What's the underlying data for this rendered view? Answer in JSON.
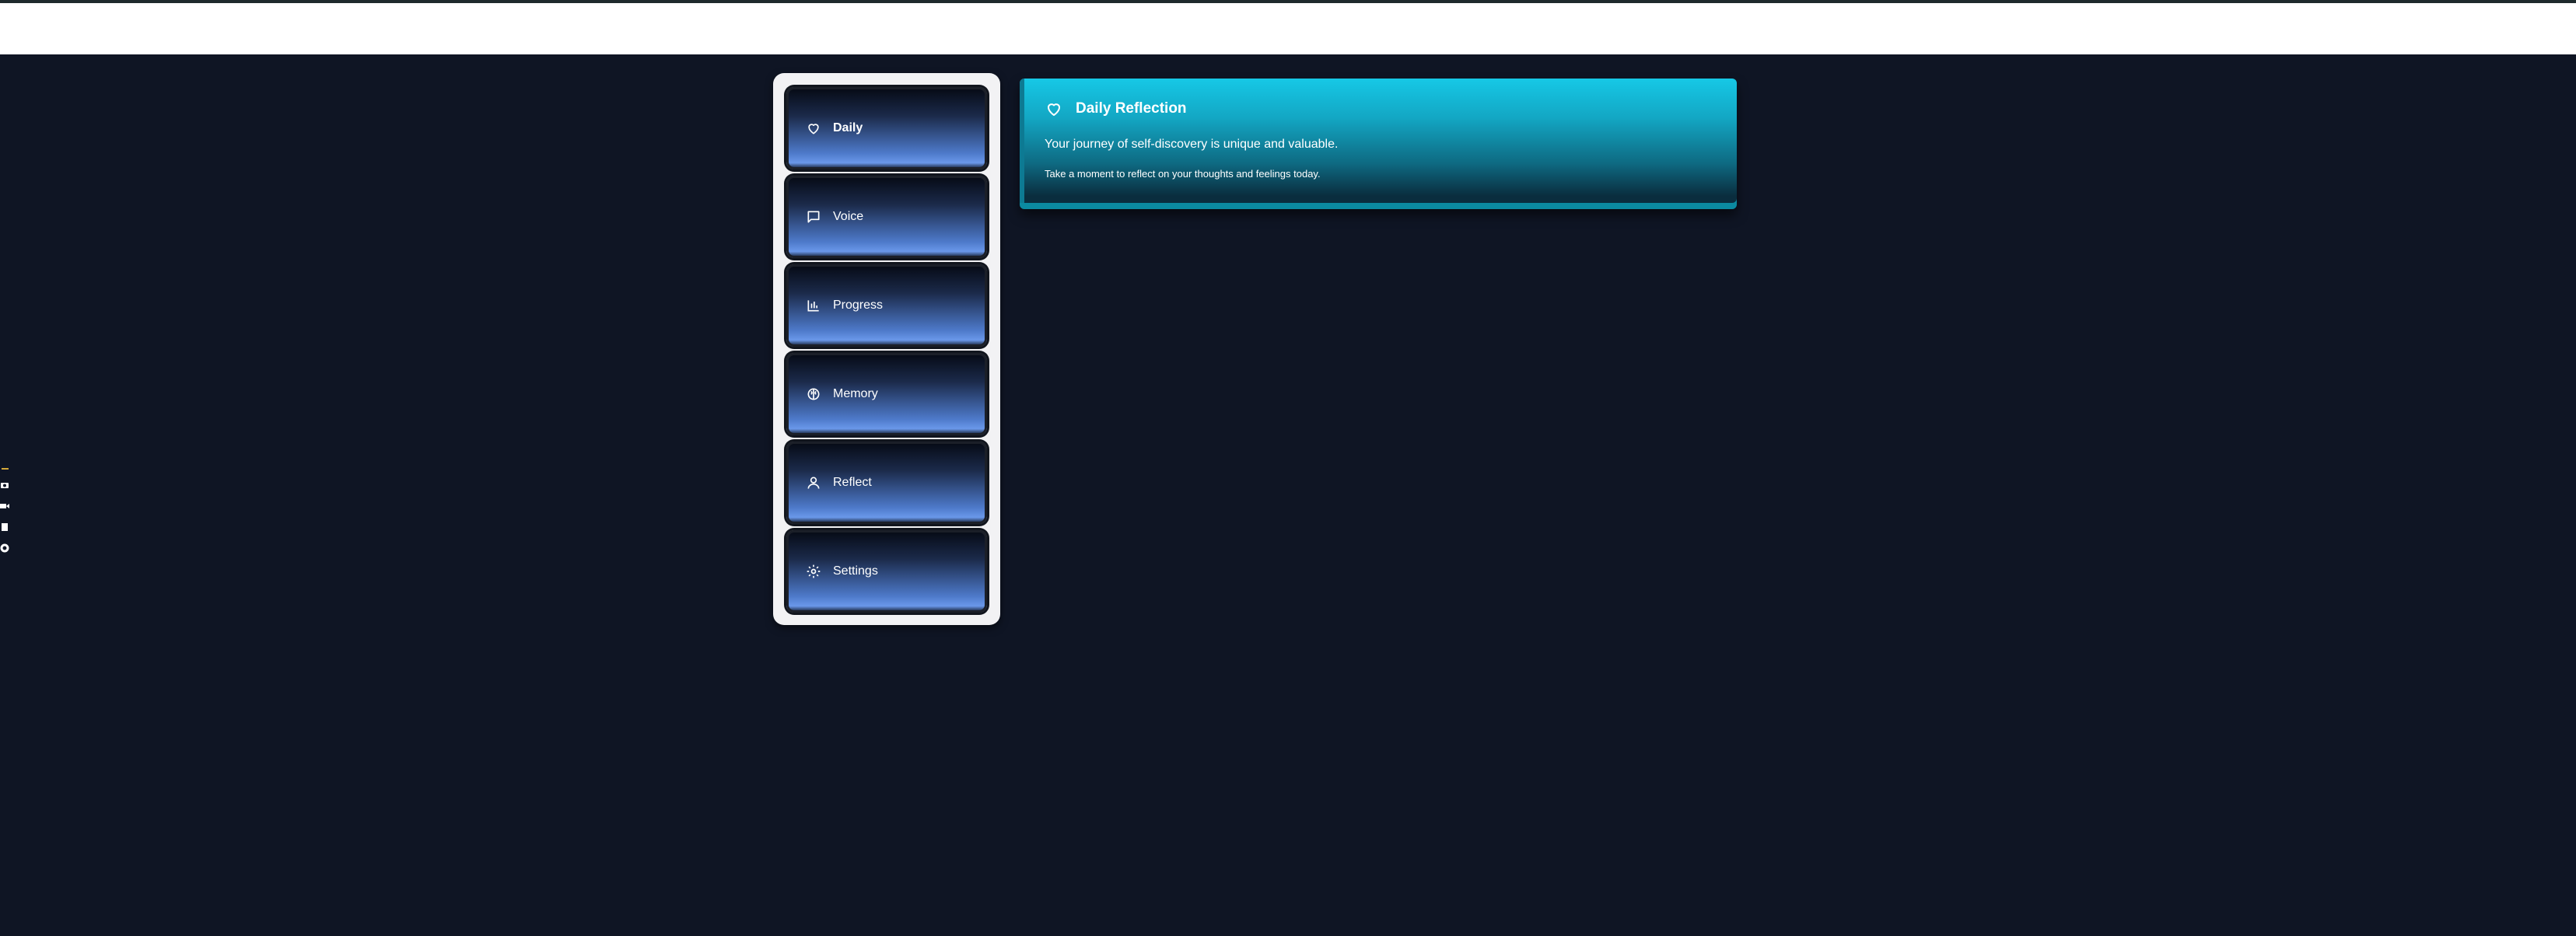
{
  "colors": {
    "background": "#0f1524",
    "top_bar": "#ffffff",
    "sidebar": "#f2f2f4",
    "nav_gradient_bottom": "#6a98ea",
    "card_accent": "#16c8e6"
  },
  "sidebar": {
    "items": [
      {
        "label": "Daily",
        "icon": "heart-icon",
        "active": true
      },
      {
        "label": "Voice",
        "icon": "message-square-icon",
        "active": false
      },
      {
        "label": "Progress",
        "icon": "bar-chart-icon",
        "active": false
      },
      {
        "label": "Memory",
        "icon": "brain-icon",
        "active": false
      },
      {
        "label": "Reflect",
        "icon": "user-icon",
        "active": false
      },
      {
        "label": "Settings",
        "icon": "gear-icon",
        "active": false
      }
    ]
  },
  "edge_tools": [
    "camera-icon",
    "video-icon",
    "file-icon",
    "settings-icon"
  ],
  "card": {
    "icon": "heart-icon",
    "title": "Daily Reflection",
    "subtitle": "Your journey of self-discovery is unique and valuable.",
    "note": "Take a moment to reflect on your thoughts and feelings today."
  }
}
